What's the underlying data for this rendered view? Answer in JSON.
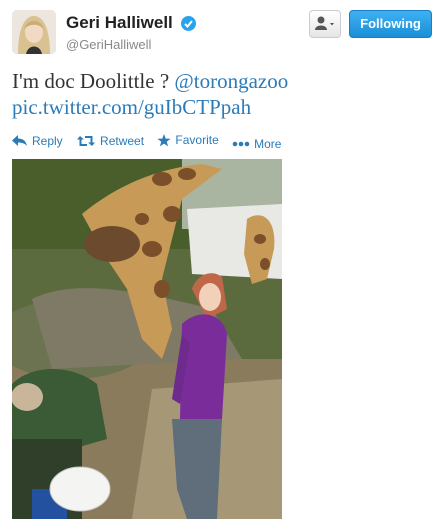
{
  "user": {
    "display_name": "Geri Halliwell",
    "screen_name": "@GeriHalliwell",
    "verified_icon": "verified-badge-icon"
  },
  "buttons": {
    "follow_label": "Following",
    "user_menu_icon": "person-dropdown-icon"
  },
  "tweet": {
    "text": "I'm doc Doolittle ? ",
    "mention": "@torongazoo",
    "link": "pic.twitter.com/guIbCTPpah"
  },
  "actions": [
    {
      "label": "Reply",
      "icon": "reply-icon"
    },
    {
      "label": "Retweet",
      "icon": "retweet-icon"
    },
    {
      "label": "Favorite",
      "icon": "star-icon"
    },
    {
      "label": "More",
      "icon": "more-dots-icon"
    }
  ],
  "colors": {
    "link": "#2b7bb9",
    "follow_button": "#2aa3ef",
    "verified": "#2aa3ef"
  }
}
